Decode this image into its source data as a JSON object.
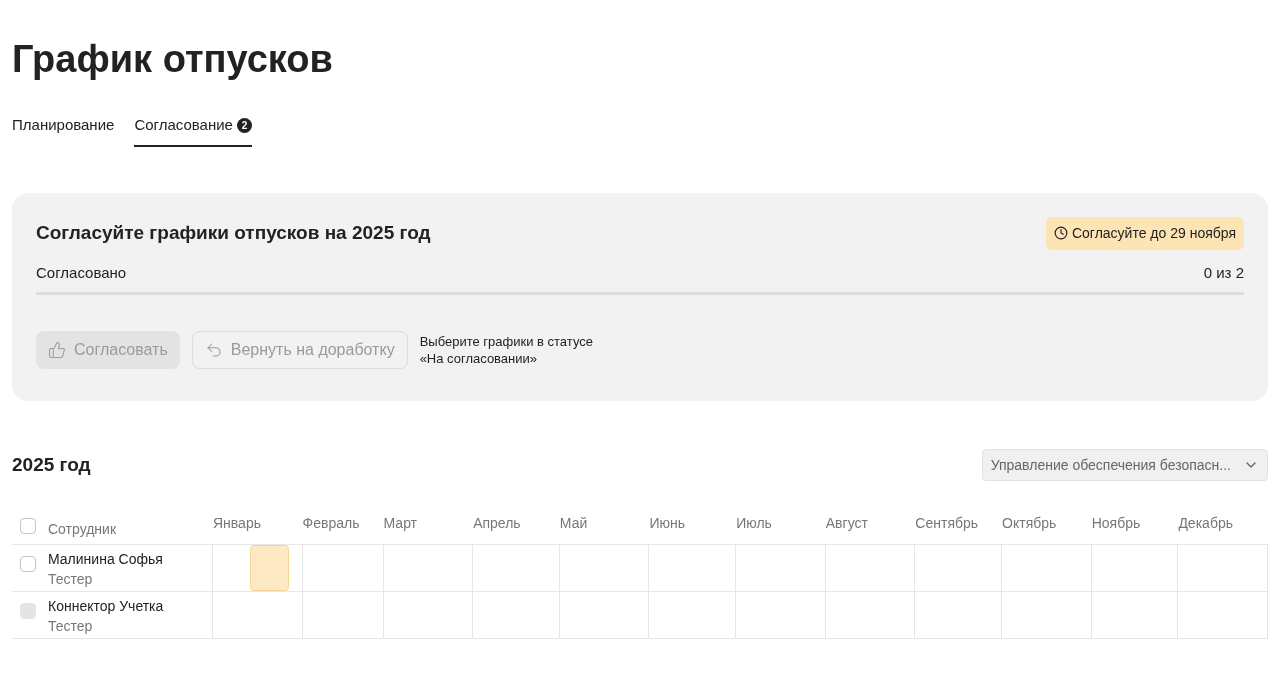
{
  "title": "График отпусков",
  "tabs": [
    {
      "label": "Планирование",
      "selected": false
    },
    {
      "label": "Согласование",
      "selected": true,
      "badge": "2"
    }
  ],
  "approval": {
    "title": "Согласуйте графики отпусков на 2025 год",
    "deadline": "Согласуйте до 29 ноября",
    "progress_label": "Согласовано",
    "progress_count": "0 из 2",
    "buttons": [
      {
        "kind": "approve",
        "label": "Согласовать",
        "disabled": true
      },
      {
        "kind": "return",
        "label": "Вернуть на доработку",
        "disabled": true
      }
    ],
    "hint": "Выберите графики в статусе «На согласовании»"
  },
  "schedule": {
    "title": "2025 год",
    "department": {
      "value": "Управление обеспечения безопасн..."
    },
    "columns": {
      "employee": "Сотрудник",
      "select_all": {
        "checked": false
      },
      "months": [
        "Январь",
        "Февраль",
        "Март",
        "Апрель",
        "Май",
        "Июнь",
        "Июль",
        "Август",
        "Сентябрь",
        "Октябрь",
        "Ноябрь",
        "Декабрь"
      ]
    },
    "rows": [
      {
        "name": "Малинина Софья",
        "role": "Тестер",
        "checked": false,
        "disabled": false,
        "months": [
          {
            "vacation": true
          },
          {
            "vacation": false
          },
          {
            "vacation": false
          },
          {
            "vacation": false
          },
          {
            "vacation": false
          },
          {
            "vacation": false
          },
          {
            "vacation": false
          },
          {
            "vacation": false
          },
          {
            "vacation": false
          },
          {
            "vacation": false
          },
          {
            "vacation": false
          },
          {
            "vacation": false
          }
        ]
      },
      {
        "name": "Коннектор Учетка",
        "role": "Тестер",
        "checked": false,
        "disabled": true,
        "months": [
          {
            "vacation": false
          },
          {
            "vacation": false
          },
          {
            "vacation": false
          },
          {
            "vacation": false
          },
          {
            "vacation": false
          },
          {
            "vacation": false
          },
          {
            "vacation": false
          },
          {
            "vacation": false
          },
          {
            "vacation": false
          },
          {
            "vacation": false
          },
          {
            "vacation": false
          },
          {
            "vacation": false
          }
        ]
      }
    ]
  }
}
